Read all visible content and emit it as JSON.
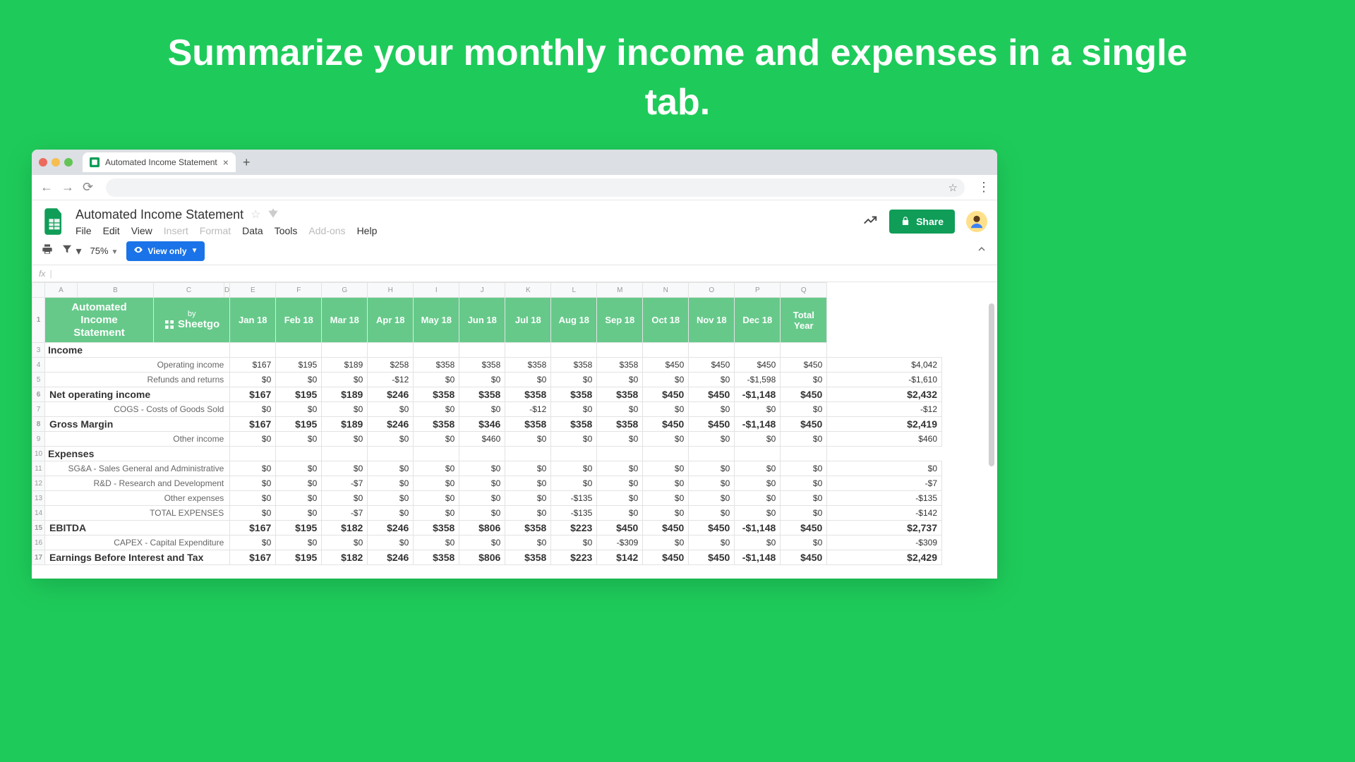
{
  "headline": "Summarize your monthly income and expenses in a single tab.",
  "browser": {
    "tab_title": "Automated Income Statement",
    "new_tab": "+",
    "close": "×"
  },
  "doc": {
    "title": "Automated Income Statement",
    "menubar": [
      "File",
      "Edit",
      "View",
      "Insert",
      "Format",
      "Data",
      "Tools",
      "Add-ons",
      "Help"
    ],
    "dim_idx": [
      3,
      4,
      7
    ],
    "share": "Share",
    "zoom": "75%",
    "viewonly": "View only",
    "fx": "fx"
  },
  "columns": [
    "A",
    "B",
    "C",
    "D",
    "E",
    "F",
    "G",
    "H",
    "I",
    "J",
    "K",
    "L",
    "M",
    "N",
    "O",
    "P",
    "Q"
  ],
  "header": {
    "ais": "Automated Income Statement",
    "by": "by",
    "brand": "Sheetgo",
    "months": [
      "Jan 18",
      "Feb 18",
      "Mar 18",
      "Apr 18",
      "May 18",
      "Jun 18",
      "Jul 18",
      "Aug 18",
      "Sep 18",
      "Oct 18",
      "Nov 18",
      "Dec 18"
    ],
    "total": "Total Year"
  },
  "rows": [
    {
      "n": 3,
      "type": "section",
      "label": "Income"
    },
    {
      "n": 4,
      "type": "data",
      "label": "Operating income",
      "vals": [
        "$167",
        "$195",
        "$189",
        "$258",
        "$358",
        "$358",
        "$358",
        "$358",
        "$358",
        "$450",
        "$450",
        "$450",
        "$450",
        "$4,042"
      ]
    },
    {
      "n": 5,
      "type": "data",
      "label": "Refunds and returns",
      "vals": [
        "$0",
        "$0",
        "$0",
        "-$12",
        "$0",
        "$0",
        "$0",
        "$0",
        "$0",
        "$0",
        "$0",
        "-$1,598",
        "$0",
        "-$1,610"
      ]
    },
    {
      "n": 6,
      "type": "bold",
      "label": "Net operating income",
      "vals": [
        "$167",
        "$195",
        "$189",
        "$246",
        "$358",
        "$358",
        "$358",
        "$358",
        "$358",
        "$450",
        "$450",
        "-$1,148",
        "$450",
        "$2,432"
      ]
    },
    {
      "n": 7,
      "type": "data",
      "label": "COGS - Costs of Goods Sold",
      "vals": [
        "$0",
        "$0",
        "$0",
        "$0",
        "$0",
        "$0",
        "-$12",
        "$0",
        "$0",
        "$0",
        "$0",
        "$0",
        "$0",
        "-$12"
      ]
    },
    {
      "n": 8,
      "type": "bold",
      "label": "Gross Margin",
      "vals": [
        "$167",
        "$195",
        "$189",
        "$246",
        "$358",
        "$346",
        "$358",
        "$358",
        "$358",
        "$450",
        "$450",
        "-$1,148",
        "$450",
        "$2,419"
      ]
    },
    {
      "n": 9,
      "type": "data",
      "label": "Other income",
      "vals": [
        "$0",
        "$0",
        "$0",
        "$0",
        "$0",
        "$460",
        "$0",
        "$0",
        "$0",
        "$0",
        "$0",
        "$0",
        "$0",
        "$460"
      ]
    },
    {
      "n": 10,
      "type": "section",
      "label": "Expenses"
    },
    {
      "n": 11,
      "type": "data",
      "label": "SG&A - Sales General and Administrative",
      "vals": [
        "$0",
        "$0",
        "$0",
        "$0",
        "$0",
        "$0",
        "$0",
        "$0",
        "$0",
        "$0",
        "$0",
        "$0",
        "$0",
        "$0"
      ]
    },
    {
      "n": 12,
      "type": "data",
      "label": "R&D - Research and Development",
      "vals": [
        "$0",
        "$0",
        "-$7",
        "$0",
        "$0",
        "$0",
        "$0",
        "$0",
        "$0",
        "$0",
        "$0",
        "$0",
        "$0",
        "-$7"
      ]
    },
    {
      "n": 13,
      "type": "data",
      "label": "Other expenses",
      "vals": [
        "$0",
        "$0",
        "$0",
        "$0",
        "$0",
        "$0",
        "$0",
        "-$135",
        "$0",
        "$0",
        "$0",
        "$0",
        "$0",
        "-$135"
      ]
    },
    {
      "n": 14,
      "type": "data",
      "label": "TOTAL EXPENSES",
      "vals": [
        "$0",
        "$0",
        "-$7",
        "$0",
        "$0",
        "$0",
        "$0",
        "-$135",
        "$0",
        "$0",
        "$0",
        "$0",
        "$0",
        "-$142"
      ]
    },
    {
      "n": 15,
      "type": "bold",
      "label": "EBITDA",
      "vals": [
        "$167",
        "$195",
        "$182",
        "$246",
        "$358",
        "$806",
        "$358",
        "$223",
        "$450",
        "$450",
        "$450",
        "-$1,148",
        "$450",
        "$2,737"
      ]
    },
    {
      "n": 16,
      "type": "data",
      "label": "CAPEX - Capital Expenditure",
      "vals": [
        "$0",
        "$0",
        "$0",
        "$0",
        "$0",
        "$0",
        "$0",
        "$0",
        "-$309",
        "$0",
        "$0",
        "$0",
        "$0",
        "-$309"
      ]
    },
    {
      "n": 17,
      "type": "bold",
      "label": "Earnings Before Interest and Tax",
      "vals": [
        "$167",
        "$195",
        "$182",
        "$246",
        "$358",
        "$806",
        "$358",
        "$223",
        "$142",
        "$450",
        "$450",
        "-$1,148",
        "$450",
        "$2,429"
      ]
    }
  ]
}
